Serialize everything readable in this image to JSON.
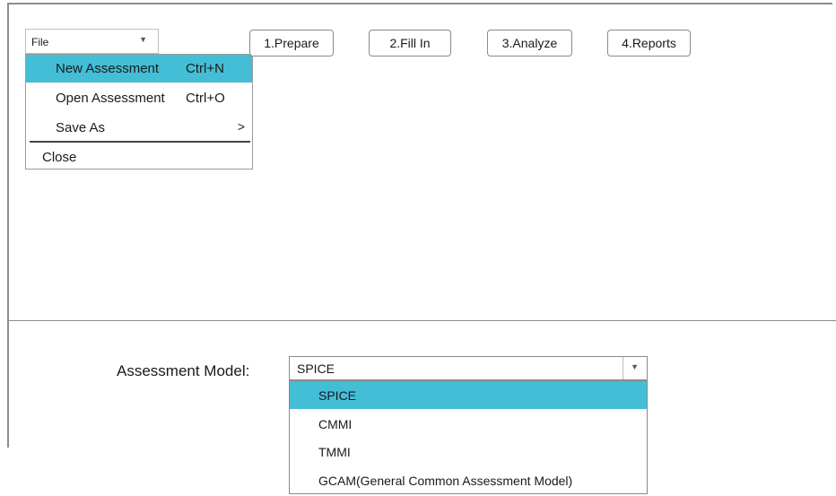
{
  "file_menu": {
    "combo_value": "File",
    "items": [
      {
        "label": "New Assessment",
        "shortcut": "Ctrl+N"
      },
      {
        "label": "Open Assessment",
        "shortcut": "Ctrl+O"
      },
      {
        "label": "Save As",
        "submenu": ">"
      },
      {
        "label": "Close"
      }
    ]
  },
  "tabs": [
    "1.Prepare",
    "2.Fill In",
    "3.Analyze",
    "4.Reports"
  ],
  "assessment_model": {
    "label": "Assessment Model:",
    "selected": "SPICE",
    "options": [
      "SPICE",
      "CMMI",
      "TMMI",
      "GCAM(General Common Assessment Model)"
    ]
  },
  "colors": {
    "highlight": "#43bed6",
    "border": "#8a8a8a"
  },
  "icons": {
    "dropdown": "chevron-down-icon"
  }
}
